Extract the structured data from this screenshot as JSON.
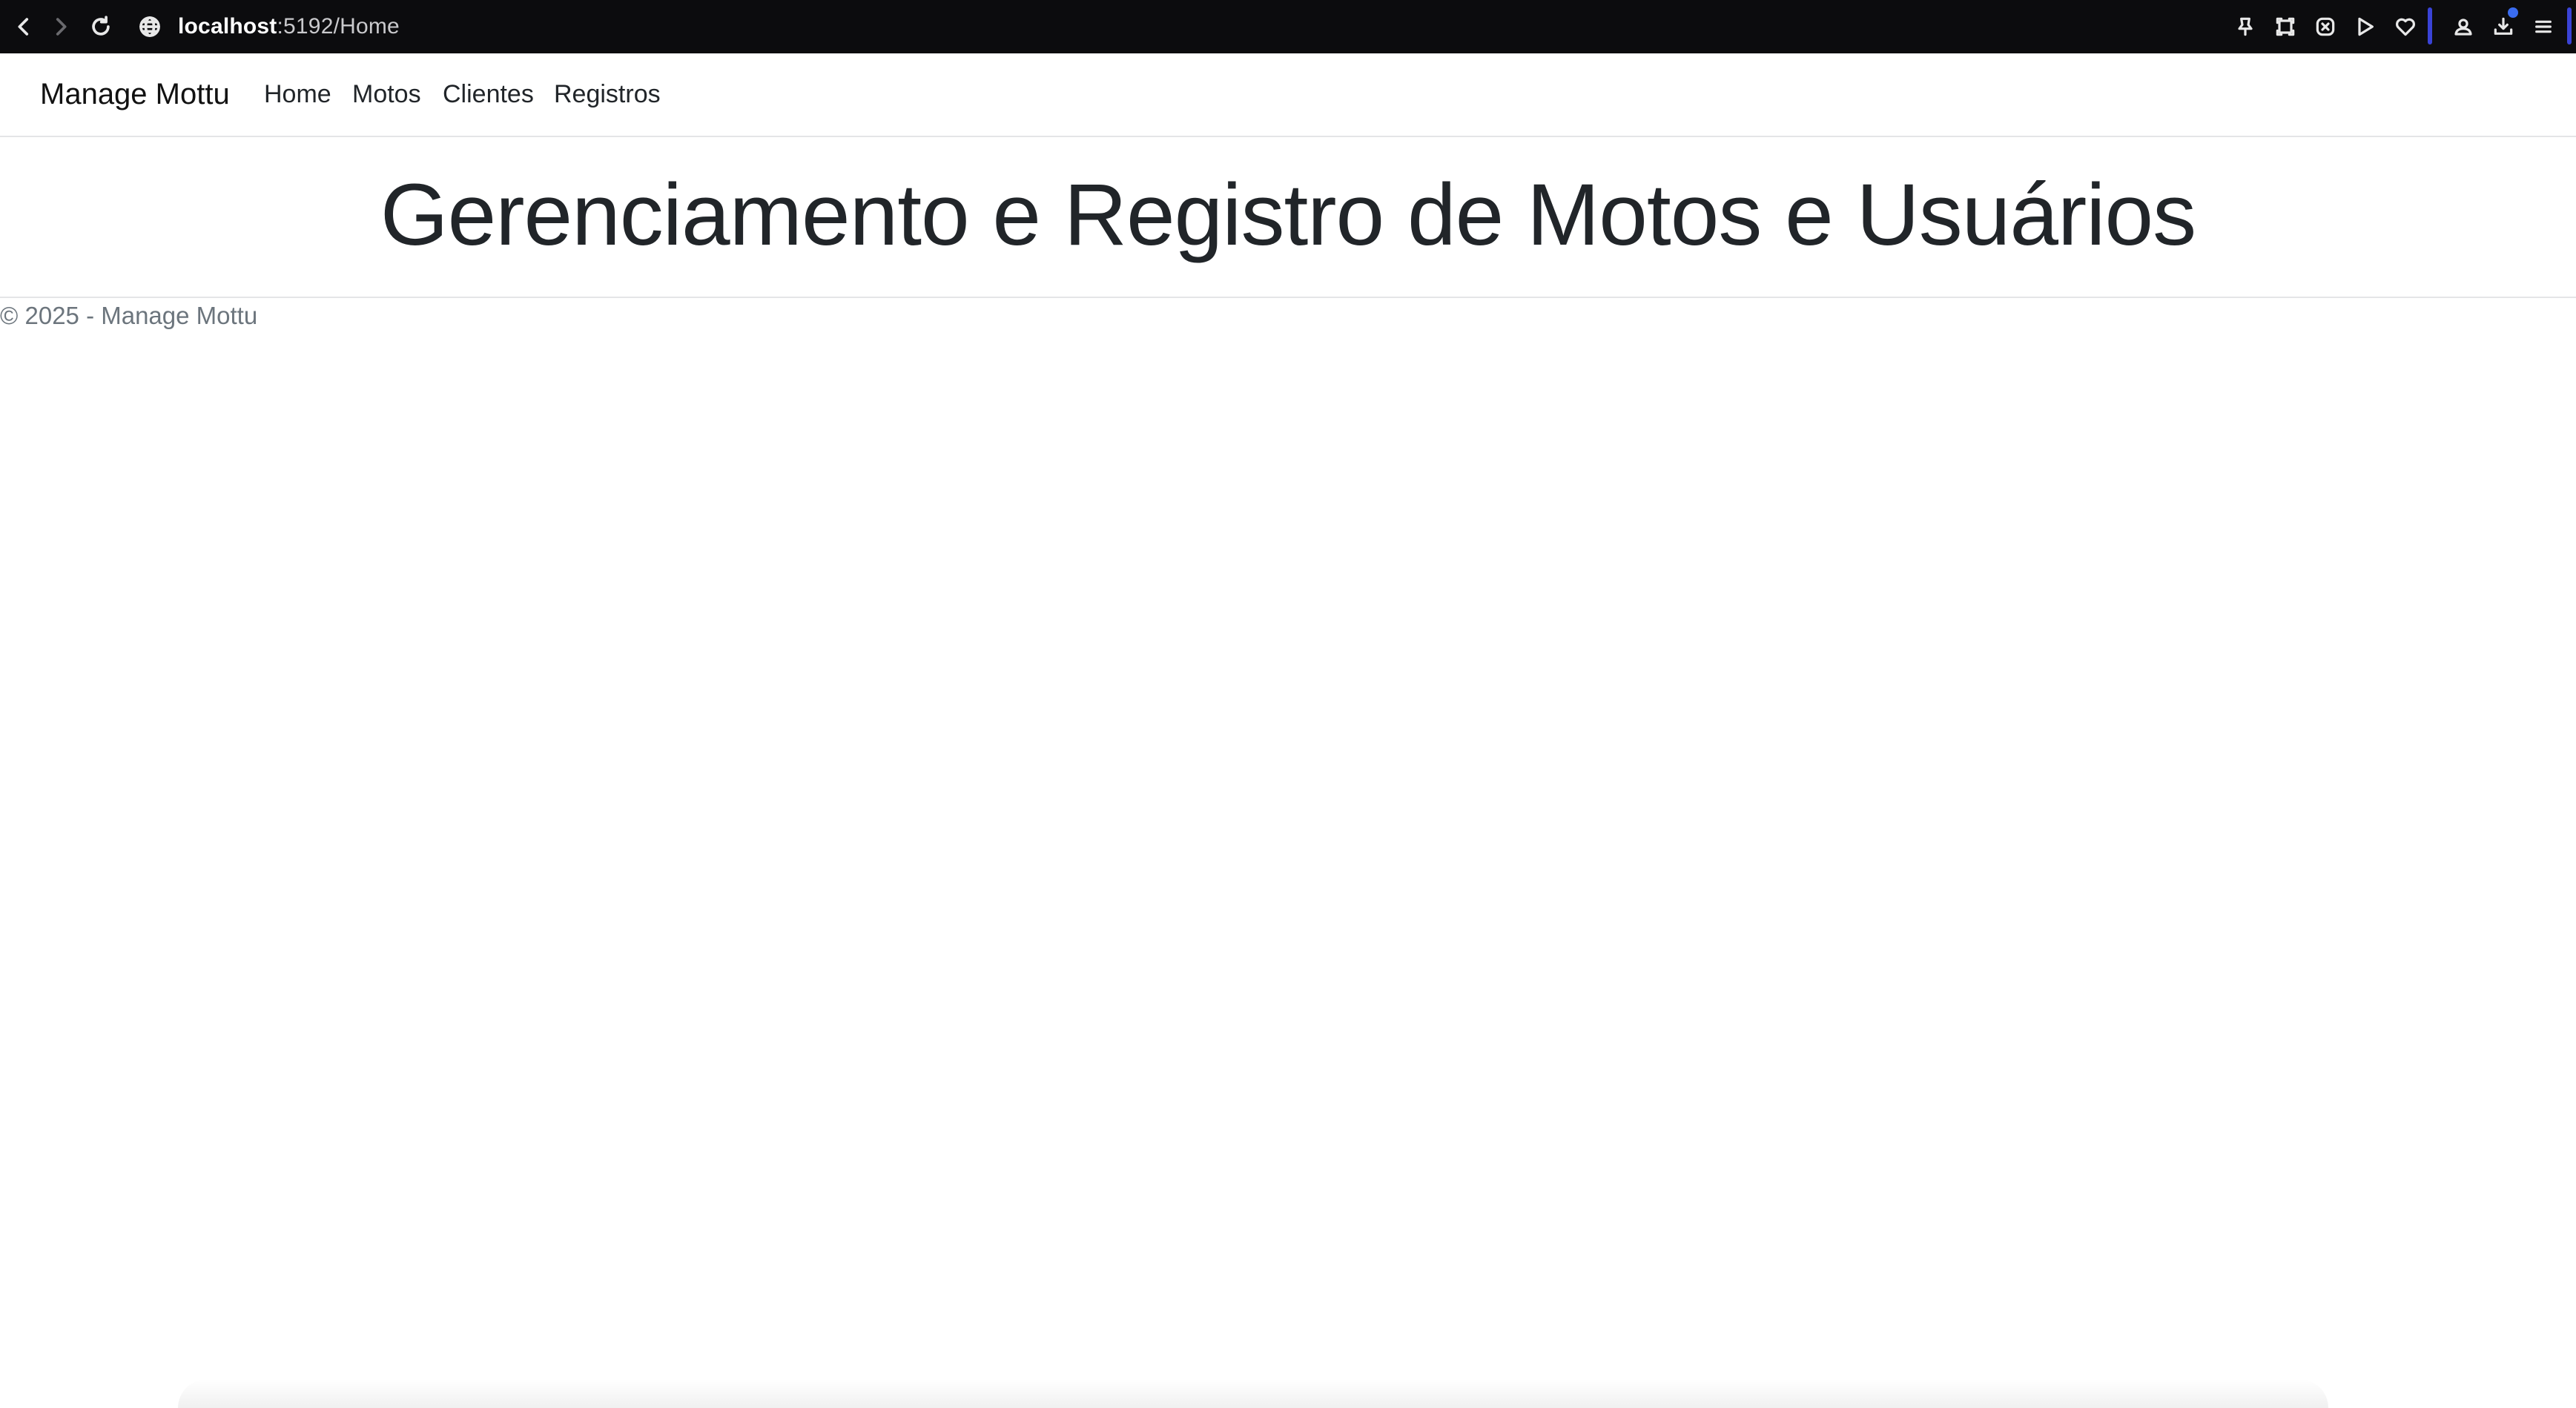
{
  "browser": {
    "url_host": "localhost",
    "url_rest": ":5192/Home",
    "icons": [
      "back-icon",
      "forward-icon",
      "reload-icon",
      "globe-icon",
      "pin-icon",
      "screenshot-icon",
      "shield-icon",
      "send-icon",
      "heart-icon",
      "profile-icon",
      "download-icon",
      "menu-icon"
    ]
  },
  "navbar": {
    "brand": "Manage Mottu",
    "links": [
      {
        "label": "Home"
      },
      {
        "label": "Motos"
      },
      {
        "label": "Clientes"
      },
      {
        "label": "Registros"
      }
    ]
  },
  "main": {
    "title": "Gerenciamento e Registro de Motos e Usuários"
  },
  "footer": {
    "text": "© 2025 - Manage Mottu"
  }
}
